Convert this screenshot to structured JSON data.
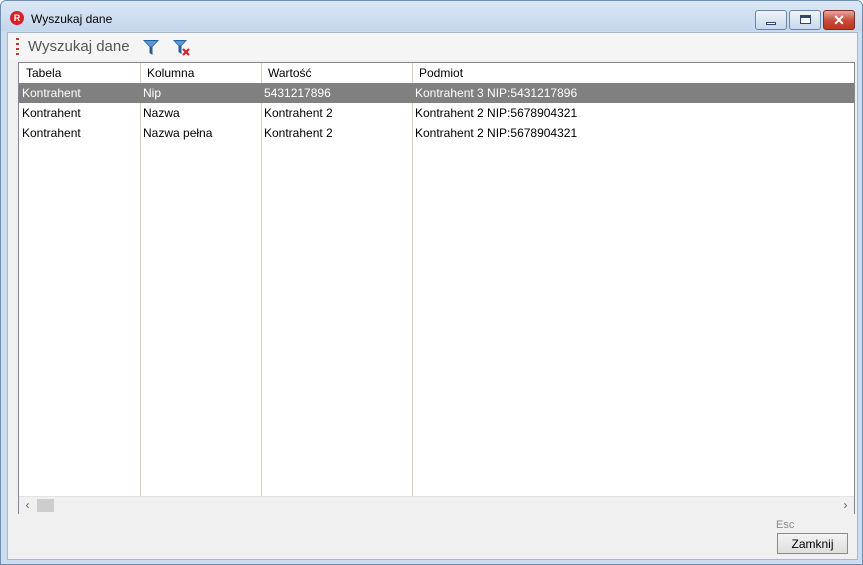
{
  "window": {
    "title": "Wyszukaj dane",
    "app_icon_letter": "R"
  },
  "toolbar": {
    "title": "Wyszukaj dane",
    "filter_icon": "filter-icon",
    "clear_filter_icon": "clear-filter-icon"
  },
  "table": {
    "columns": [
      "Tabela",
      "Kolumna",
      "Wartość",
      "Podmiot"
    ],
    "rows": [
      {
        "tabela": "Kontrahent",
        "kolumna": "Nip",
        "wartosc": "5431217896",
        "podmiot": "Kontrahent 3 NIP:5431217896",
        "selected": true
      },
      {
        "tabela": "Kontrahent",
        "kolumna": "Nazwa",
        "wartosc": "Kontrahent 2",
        "podmiot": "Kontrahent 2 NIP:5678904321",
        "selected": false
      },
      {
        "tabela": "Kontrahent",
        "kolumna": "Nazwa pełna",
        "wartosc": "Kontrahent 2",
        "podmiot": "Kontrahent 2 NIP:5678904321",
        "selected": false
      }
    ]
  },
  "footer": {
    "shortcut_hint": "Esc",
    "close_label": "Zamknij"
  },
  "colors": {
    "selected_row": "#808080",
    "accent": "#d9202a",
    "filter_icon": "#1f5fa6"
  }
}
